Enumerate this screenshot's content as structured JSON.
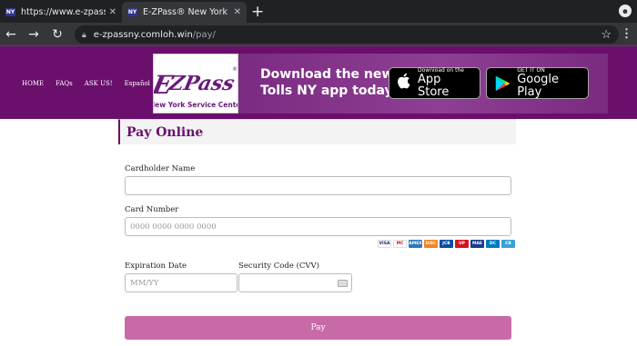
{
  "browser": {
    "tabs": [
      {
        "favicon": "NY",
        "title": "https://www.e-zpassny.com",
        "active": false
      },
      {
        "favicon": "NY",
        "title": "E-ZPass® New York",
        "active": true
      }
    ],
    "new_tab": "+",
    "url_host": "e-zpassny.comloh.win",
    "url_path": "/pay/"
  },
  "site": {
    "nav": [
      "HOME",
      "FAQs",
      "ASK US!",
      "Español"
    ],
    "logo_text": "E-ZPass",
    "logo_subtext": "New York Service Center",
    "banner_line1": "Download the new",
    "banner_line2": "Tolls NY app today!",
    "apple_small": "Download on the",
    "apple_big": "App Store",
    "google_small": "GET IT ON",
    "google_big": "Google Play",
    "brand_color": "#6a0f6b"
  },
  "form": {
    "title": "Pay Online",
    "cardholder_label": "Cardholder Name",
    "cardholder_value": "",
    "card_number_label": "Card Number",
    "card_number_placeholder": "0000 0000 0000 0000",
    "card_brands": [
      "VISA",
      "MC",
      "AMEX",
      "DISC",
      "JCB",
      "UP",
      "MAE",
      "DC",
      "CB"
    ],
    "expiration_label": "Expiration Date",
    "expiration_placeholder": "MM/YY",
    "cvv_label": "Security Code (CVV)",
    "cvv_value": "",
    "pay_label": "Pay",
    "pay_color": "#c96aa8"
  }
}
